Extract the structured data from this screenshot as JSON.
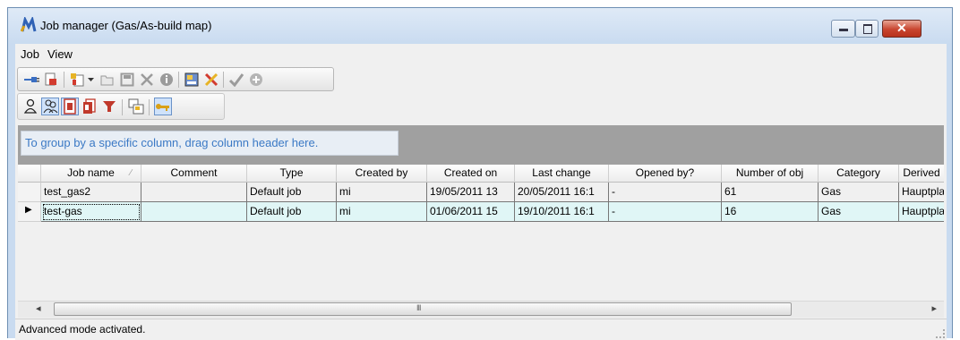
{
  "window": {
    "title": "Job manager (Gas/As-build map)",
    "close_glyph": "✕",
    "min_glyph": "▭",
    "max_glyph": "▫",
    "accent_color": "#3b79c5"
  },
  "menu": [
    "Job",
    "View"
  ],
  "toolbar1": [
    {
      "icon": "connect-plug-icon"
    },
    {
      "icon": "disconnect-icon"
    },
    {
      "icon": "new-job-icon"
    },
    {
      "icon": "dropdown-arrow-icon"
    },
    {
      "icon": "open-folder-icon"
    },
    {
      "icon": "save-disk-icon"
    },
    {
      "icon": "delete-x-icon"
    },
    {
      "icon": "info-icon"
    },
    {
      "icon": "properties-icon"
    },
    {
      "icon": "tools-icon"
    },
    {
      "icon": "check-icon"
    },
    {
      "icon": "add-plus-icon"
    }
  ],
  "toolbar2": [
    {
      "icon": "user-icon"
    },
    {
      "icon": "users-group-icon"
    },
    {
      "icon": "red-document-icon"
    },
    {
      "icon": "red-documents-icon"
    },
    {
      "icon": "filter-funnel-icon"
    },
    {
      "icon": "copy-windows-icon"
    },
    {
      "icon": "advanced-key-icon"
    }
  ],
  "grid": {
    "group_hint": "To group by a specific column, drag column header here.",
    "sort_indicator": "∕",
    "columns": [
      "Job name",
      "Comment",
      "Type",
      "Created by",
      "Created on",
      "Last change",
      "Opened by?",
      "Number of obj",
      "Category",
      "Derived"
    ],
    "rows": [
      [
        "test_gas2",
        "",
        "Default job",
        "mi",
        "19/05/2011 13",
        "20/05/2011 16:1",
        "-",
        "61",
        "Gas",
        "Hauptpla"
      ],
      [
        "test-gas",
        "",
        "Default job",
        "mi",
        "01/06/2011 15",
        "19/10/2011 16:1",
        "-",
        "16",
        "Gas",
        "Hauptpla"
      ]
    ],
    "selected_row_marker": "▶",
    "scroll_left": "◂",
    "scroll_right": "▸",
    "scroll_grip": "III"
  },
  "status": {
    "text": "Advanced mode activated."
  }
}
